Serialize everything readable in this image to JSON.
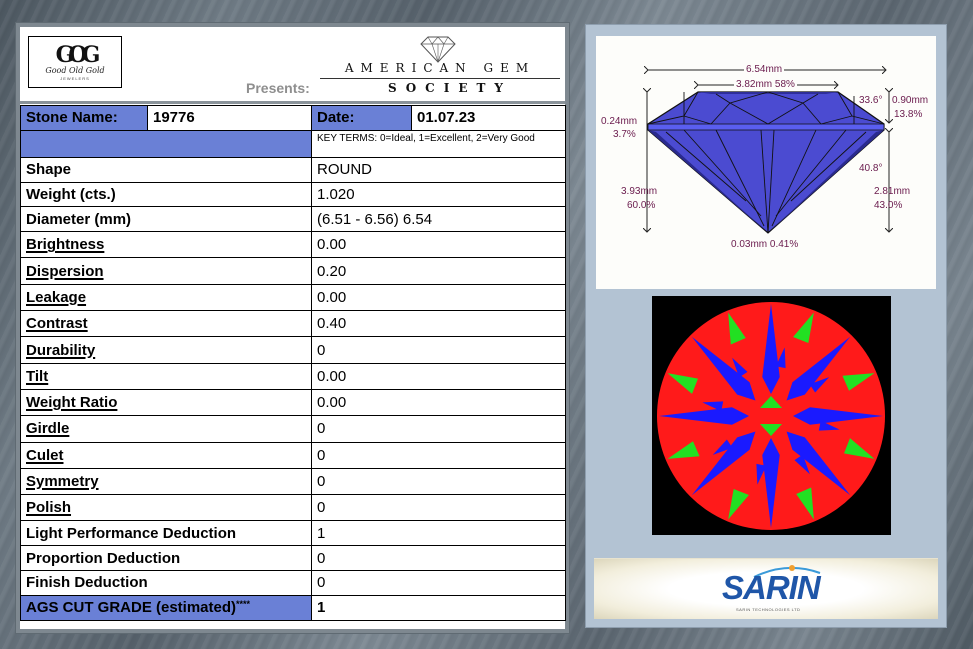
{
  "header": {
    "logo": {
      "monogram": "GOG",
      "name": "Good Old Gold",
      "sub": "JEWELERS"
    },
    "presents_label": "Presents:",
    "ags_line1": "AMERICAN GEM",
    "ags_line2": "SOCIETY"
  },
  "report": {
    "stone_name_label": "Stone Name:",
    "stone_name": "19776",
    "date_label": "Date:",
    "date": "01.07.23",
    "key_terms": "KEY TERMS: 0=Ideal, 1=Excellent, 2=Very Good",
    "rows": [
      {
        "label": "Shape",
        "value": "ROUND"
      },
      {
        "label": "Weight (cts.)",
        "value": "1.020"
      },
      {
        "label": "Diameter (mm)",
        "value": "(6.51 - 6.56) 6.54"
      },
      {
        "label": "Brightness",
        "value": "0.00"
      },
      {
        "label": "Dispersion",
        "value": "0.20"
      },
      {
        "label": "Leakage",
        "value": "0.00"
      },
      {
        "label": "Contrast",
        "value": "0.40"
      },
      {
        "label": "Durability",
        "value": "0"
      },
      {
        "label": "Tilt",
        "value": "0.00"
      },
      {
        "label": "Weight Ratio",
        "value": "0.00"
      },
      {
        "label": "Girdle",
        "value": "0"
      },
      {
        "label": "Culet",
        "value": "0"
      },
      {
        "label": "Symmetry",
        "value": "0"
      },
      {
        "label": "Polish",
        "value": "0"
      },
      {
        "label": "Light Performance Deduction",
        "value": "1"
      },
      {
        "label": "Proportion Deduction",
        "value": "0"
      },
      {
        "label": "Finish Deduction",
        "value": "0"
      }
    ],
    "cut_grade_label": "AGS CUT GRADE (estimated)",
    "cut_grade_suffix": "****",
    "cut_grade": "1"
  },
  "profile": {
    "diameter": "6.54mm",
    "table": "3.82mm 58%",
    "girdle_mm": "0.24mm",
    "girdle_pct": "3.7%",
    "total_depth_mm": "3.93mm",
    "total_depth_pct": "60.0%",
    "crown_angle": "33.6°",
    "crown_height_mm": "0.90mm",
    "crown_height_pct": "13.8%",
    "pavilion_angle": "40.8°",
    "pavilion_depth_mm": "2.81mm",
    "pavilion_depth_pct": "43.0%",
    "culet": "0.03mm 0.41%"
  },
  "colors": {
    "accent_blue": "#6a80d6",
    "diamond_blue": "#4a4ad0",
    "asi_red": "#ff1a1a",
    "asi_blue": "#1a1aff",
    "asi_green": "#22e022",
    "annotation": "#6a1b4d"
  },
  "sarin": {
    "brand": "SARIN",
    "sub": "SARIN TECHNOLOGIES LTD"
  }
}
